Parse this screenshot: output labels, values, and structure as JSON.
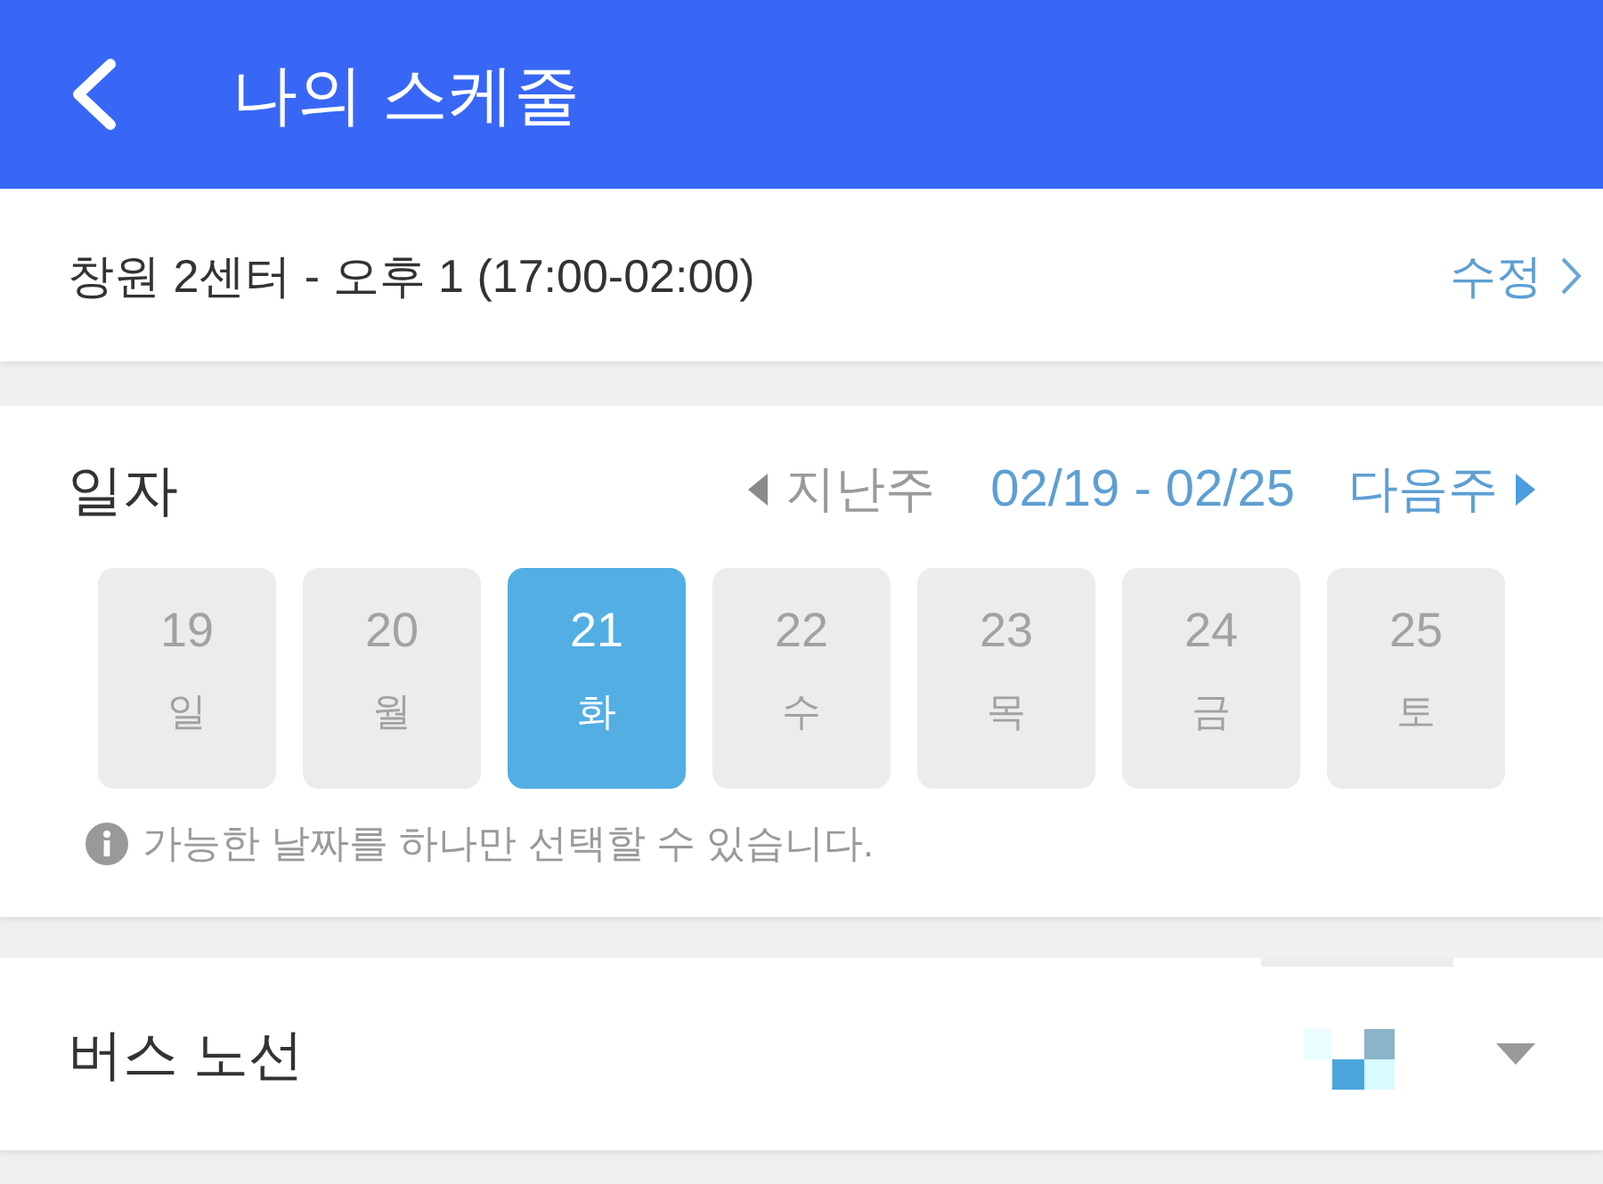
{
  "header": {
    "title": "나의 스케줄"
  },
  "shift": {
    "text": "창원 2센터 - 오후 1 (17:00-02:00)",
    "edit_link": "수정"
  },
  "date_section": {
    "label": "일자",
    "prev_week": {
      "label": "지난주",
      "disabled": true
    },
    "range": "02/19 - 02/25",
    "next_week": {
      "label": "다음주",
      "disabled": false
    },
    "days": [
      {
        "date": "19",
        "weekday": "일",
        "selected": false
      },
      {
        "date": "20",
        "weekday": "월",
        "selected": false
      },
      {
        "date": "21",
        "weekday": "화",
        "selected": true
      },
      {
        "date": "22",
        "weekday": "수",
        "selected": false
      },
      {
        "date": "23",
        "weekday": "목",
        "selected": false
      },
      {
        "date": "24",
        "weekday": "금",
        "selected": false
      },
      {
        "date": "25",
        "weekday": "토",
        "selected": false
      }
    ],
    "note": "가능한 날짜를 하나만 선택할 수 있습니다."
  },
  "bus_route": {
    "label": "버스 노선"
  }
}
